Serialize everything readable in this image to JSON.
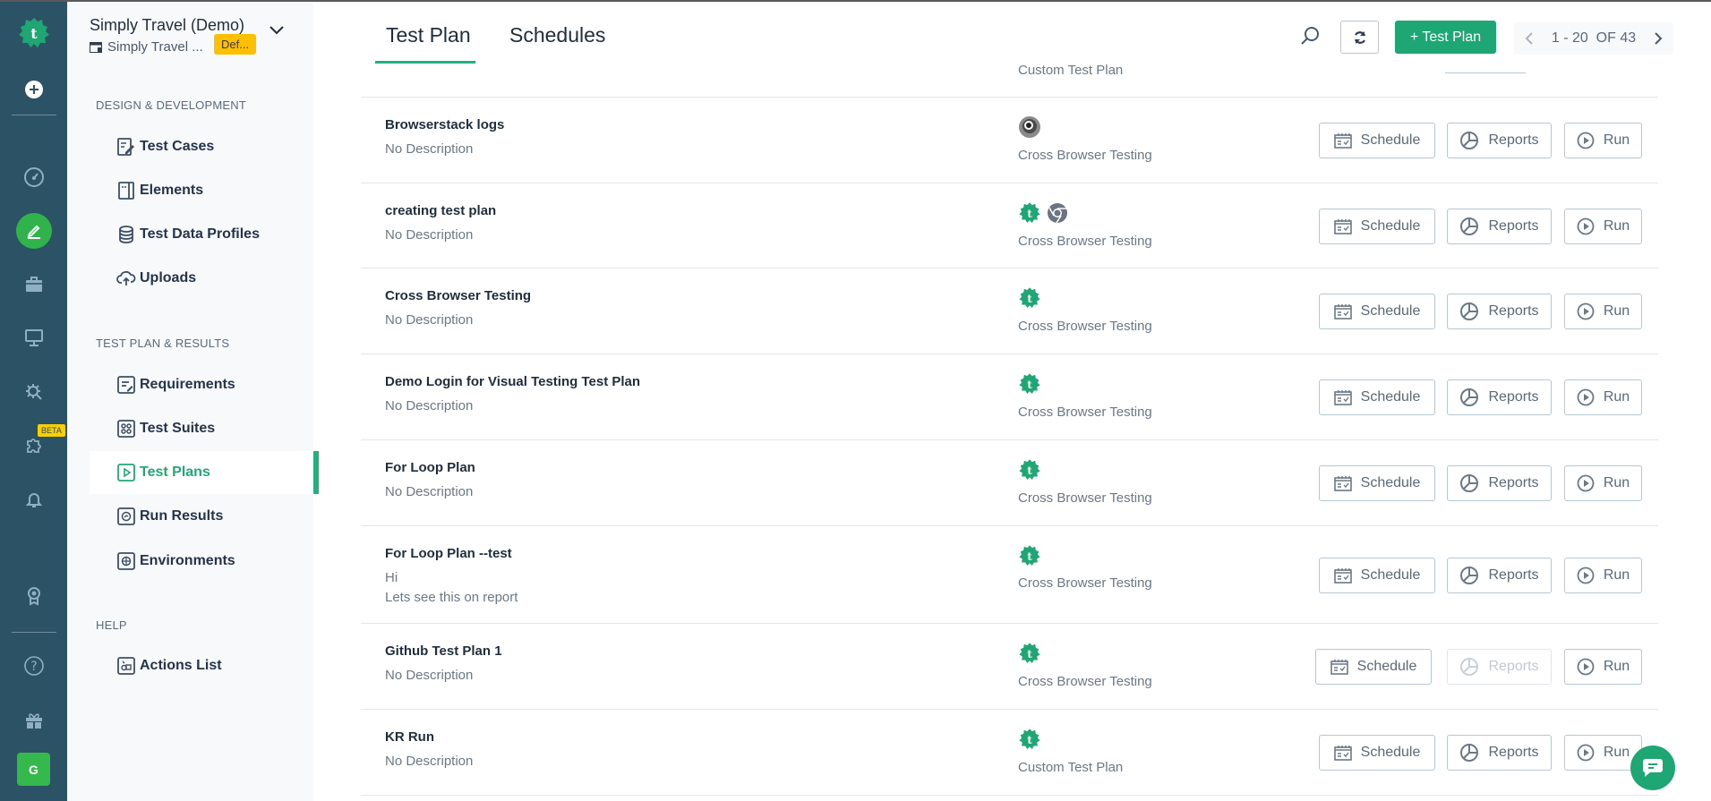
{
  "workspace": {
    "title": "Simply Travel (Demo)",
    "subtitle": "Simply Travel ...",
    "badge": "Def..."
  },
  "rail": {
    "items": [
      {
        "icon": "logo-icon"
      },
      {
        "icon": "plus-circle-icon"
      },
      {
        "icon": "dashboard-icon"
      },
      {
        "icon": "pencil-icon",
        "active": true
      },
      {
        "icon": "briefcase-icon"
      },
      {
        "icon": "monitor-icon"
      },
      {
        "icon": "settings-wrench-icon"
      },
      {
        "icon": "puzzle-icon",
        "badge": "BETA"
      },
      {
        "icon": "bell-icon"
      },
      {
        "icon": "award-icon"
      },
      {
        "icon": "help-icon"
      },
      {
        "icon": "gift-icon"
      }
    ],
    "beta_label": "BETA",
    "avatar_initial": "G"
  },
  "nav": {
    "sections": [
      {
        "label": "DESIGN & DEVELOPMENT",
        "items": [
          {
            "label": "Test Cases",
            "icon": "test-cases-icon"
          },
          {
            "label": "Elements",
            "icon": "elements-icon"
          },
          {
            "label": "Test Data Profiles",
            "icon": "database-icon"
          },
          {
            "label": "Uploads",
            "icon": "cloud-upload-icon"
          }
        ]
      },
      {
        "label": "TEST PLAN & RESULTS",
        "items": [
          {
            "label": "Requirements",
            "icon": "requirements-icon"
          },
          {
            "label": "Test Suites",
            "icon": "test-suites-icon"
          },
          {
            "label": "Test Plans",
            "icon": "test-plans-icon",
            "active": true
          },
          {
            "label": "Run Results",
            "icon": "run-results-icon"
          },
          {
            "label": "Environments",
            "icon": "globe-icon"
          }
        ]
      },
      {
        "label": "HELP",
        "items": [
          {
            "label": "Actions List",
            "icon": "actions-list-icon"
          }
        ]
      }
    ]
  },
  "header": {
    "tabs": [
      {
        "label": "Test Plan",
        "active": true
      },
      {
        "label": "Schedules",
        "active": false
      }
    ],
    "add_button": "+ Test Plan",
    "pagination": "1 - 20  OF 43"
  },
  "list": {
    "partial_top_type": "Custom Test Plan",
    "buttons": {
      "schedule": "Schedule",
      "reports": "Reports",
      "run": "Run"
    },
    "rows": [
      {
        "name": "Browserstack logs",
        "desc": [
          "No Description"
        ],
        "icons": [
          "browserstack-icon"
        ],
        "type": "Cross Browser Testing",
        "reports_disabled": false
      },
      {
        "name": "creating test plan",
        "desc": [
          "No Description"
        ],
        "icons": [
          "testsigma-icon",
          "chrome-icon"
        ],
        "type": "Cross Browser Testing",
        "reports_disabled": false
      },
      {
        "name": "Cross Browser Testing",
        "desc": [
          "No Description"
        ],
        "icons": [
          "testsigma-icon"
        ],
        "type": "Cross Browser Testing",
        "reports_disabled": false
      },
      {
        "name": "Demo Login for Visual Testing Test Plan",
        "desc": [
          "No Description"
        ],
        "icons": [
          "testsigma-icon"
        ],
        "type": "Cross Browser Testing",
        "reports_disabled": false
      },
      {
        "name": "For Loop Plan",
        "desc": [
          "No Description"
        ],
        "icons": [
          "testsigma-icon"
        ],
        "type": "Cross Browser Testing",
        "reports_disabled": false
      },
      {
        "name": "For Loop Plan --test",
        "desc": [
          "Hi",
          "Lets see this on report"
        ],
        "icons": [
          "testsigma-icon"
        ],
        "type": "Cross Browser Testing",
        "reports_disabled": false
      },
      {
        "name": "Github Test Plan 1",
        "desc": [
          "No Description"
        ],
        "icons": [
          "testsigma-icon"
        ],
        "type": "Cross Browser Testing",
        "reports_disabled": true
      },
      {
        "name": "KR Run",
        "desc": [
          "No Description"
        ],
        "icons": [
          "testsigma-icon"
        ],
        "type": "Custom Test Plan",
        "reports_disabled": false
      }
    ]
  },
  "colors": {
    "rail_bg": "#2c5266",
    "accent": "#1ea774",
    "active_nav": "#22a875",
    "badge": "#fcc000"
  }
}
